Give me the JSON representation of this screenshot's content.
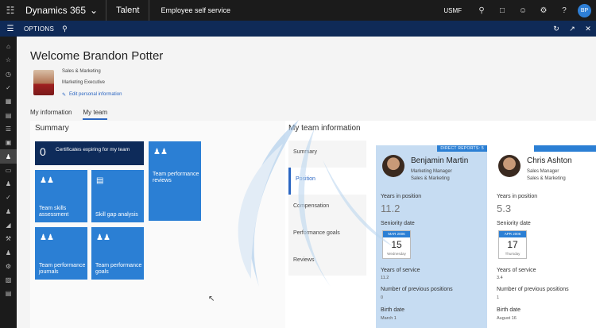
{
  "topbar": {
    "product": "Dynamics 365",
    "app": "Talent",
    "area": "Employee self service",
    "company": "USMF",
    "avatar_initials": "BP"
  },
  "optbar": {
    "label": "OPTIONS"
  },
  "profile": {
    "welcome": "Welcome Brandon Potter",
    "department": "Sales & Marketing",
    "job_title": "Marketing Executive",
    "edit_link": "Edit personal information"
  },
  "tabs": [
    {
      "label": "My information",
      "active": false
    },
    {
      "label": "My team",
      "active": true
    }
  ],
  "summary": {
    "heading": "Summary",
    "cert_count": "0",
    "cert_text": "Certificates expiring for my team",
    "tiles": {
      "skills": "Team skills assessment",
      "gap": "Skill gap analysis",
      "reviews": "Team performance reviews",
      "journals": "Team performance journals",
      "goals": "Team performance goals"
    }
  },
  "team_info": {
    "heading": "My team information",
    "vtabs": [
      "Summary",
      "Position",
      "Compensation",
      "Performance goals",
      "Reviews"
    ],
    "active_tab": "Position"
  },
  "cards": [
    {
      "banner": "DIRECT REPORTS: 5",
      "name": "Benjamin Martin",
      "title": "Marketing Manager",
      "department": "Sales & Marketing",
      "years_in_position_label": "Years in position",
      "years_in_position": "11.2",
      "seniority_label": "Seniority date",
      "seniority_month": "MAR 2006",
      "seniority_day": "15",
      "seniority_weekday": "Wednesday",
      "years_service_label": "Years of service",
      "years_service": "11.2",
      "prev_positions_label": "Number of previous positions",
      "prev_positions": "0",
      "birth_label": "Birth date",
      "birth": "March 1"
    },
    {
      "name": "Chris Ashton",
      "title": "Sales Manager",
      "department": "Sales & Marketing",
      "years_in_position_label": "Years in position",
      "years_in_position": "5.3",
      "seniority_label": "Seniority date",
      "seniority_month": "APR 2006",
      "seniority_day": "17",
      "seniority_weekday": "Thursday",
      "years_service_label": "Years of service",
      "years_service": "3.4",
      "prev_positions_label": "Number of previous positions",
      "prev_positions": "1",
      "birth_label": "Birth date",
      "birth": "August 16"
    }
  ]
}
